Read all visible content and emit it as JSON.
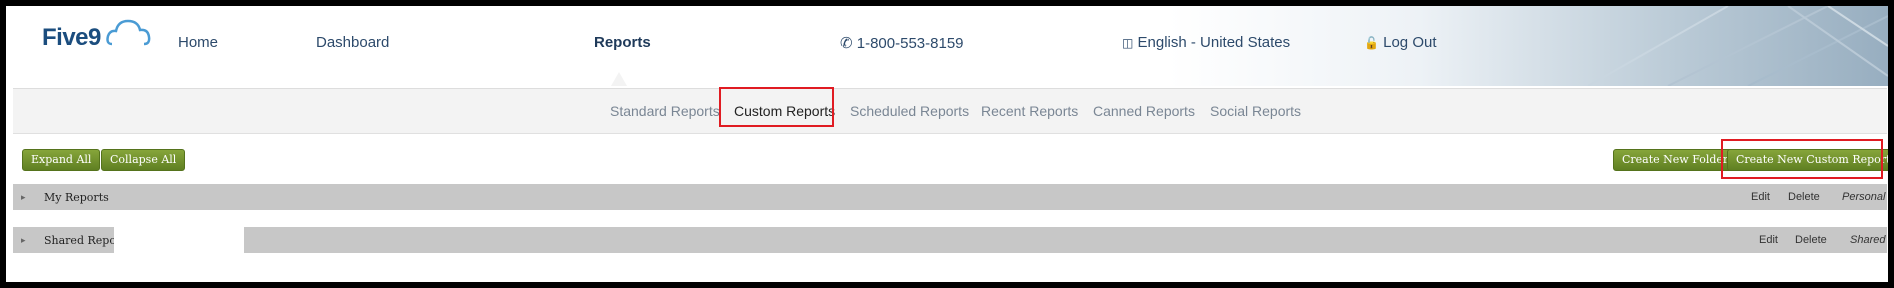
{
  "brand": {
    "logo_text": "Five9"
  },
  "nav": {
    "home": "Home",
    "dashboard": "Dashboard",
    "reports": "Reports",
    "phone": "1-800-553-8159",
    "language": "English - United States",
    "logout": "Log Out"
  },
  "subnav": {
    "standard": "Standard Reports",
    "custom": "Custom Reports",
    "scheduled": "Scheduled Reports",
    "recent": "Recent Reports",
    "canned": "Canned Reports",
    "social": "Social Reports"
  },
  "toolbar": {
    "expand_all": "Expand All",
    "collapse_all": "Collapse All",
    "create_folder": "Create New Folder",
    "create_custom": "Create New Custom Report"
  },
  "folders": [
    {
      "name": "My Reports",
      "edit": "Edit",
      "delete": "Delete",
      "scope": "Personal"
    },
    {
      "name": "Shared Reports",
      "edit": "Edit",
      "delete": "Delete",
      "scope": "Shared"
    }
  ],
  "colors": {
    "accent_green": "#6f8f2b",
    "highlight_red": "#e01b22",
    "nav_blue": "#2d4a6b"
  }
}
